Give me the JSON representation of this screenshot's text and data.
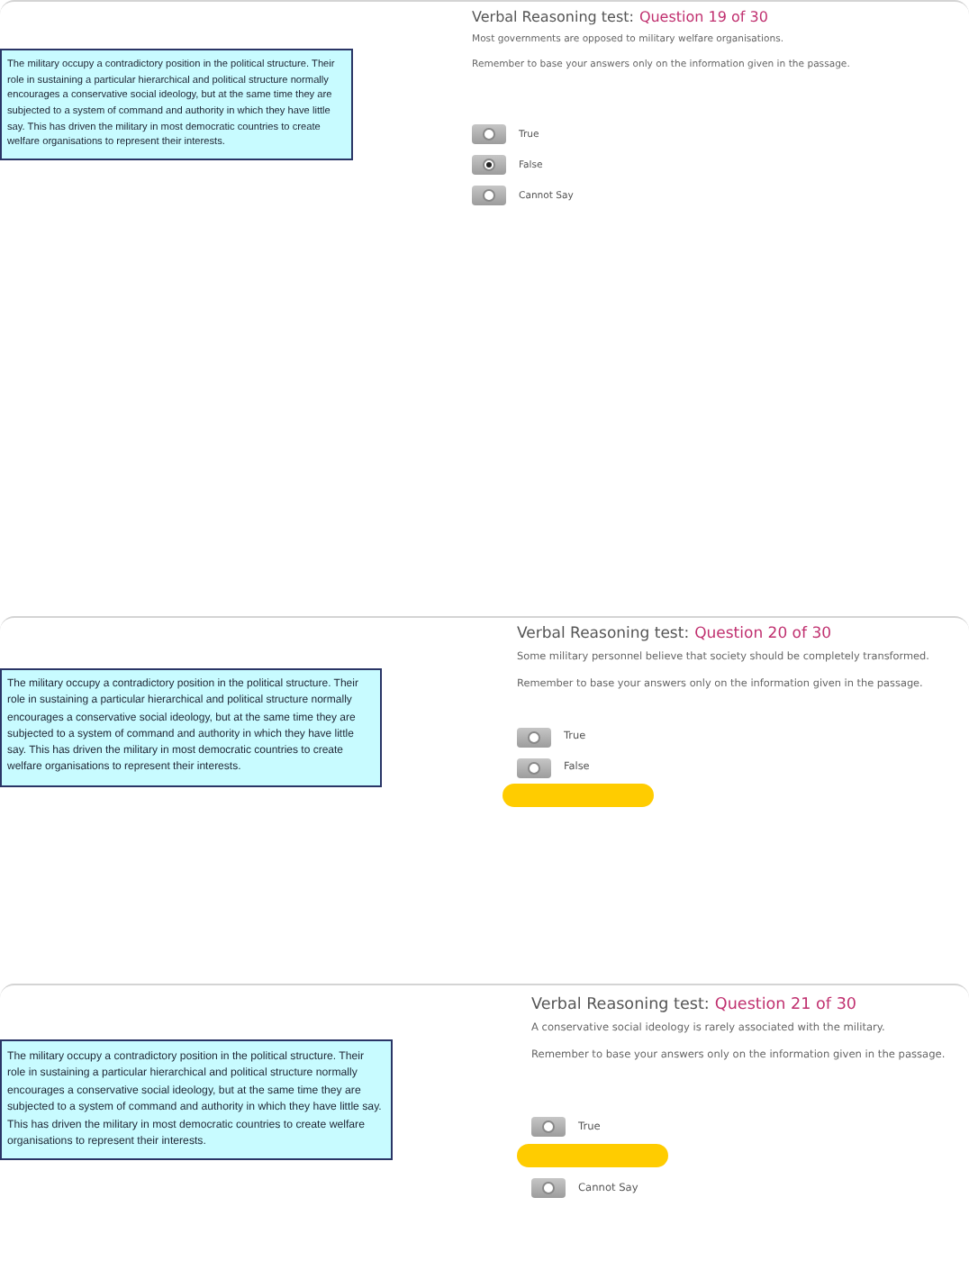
{
  "panels": [
    {
      "test_label": "Verbal Reasoning test:",
      "question_label": "Question 19 of 30",
      "passage": "The military occupy a contradictory position in the political structure. Their role in sustaining a particular hierarchical and political structure normally encourages a conservative social ideology, but at the same time they are subjected to a system of command and authority in which they have little say. This has driven the military in most democratic countries to create welfare organisations to represent their interests.",
      "statement": "Most governments are opposed to military welfare organisations.",
      "instruction": "Remember to base your answers only on the information given in the passage.",
      "options": [
        {
          "kind": "option",
          "label": "True",
          "selected": false
        },
        {
          "kind": "option",
          "label": "False",
          "selected": true
        },
        {
          "kind": "option",
          "label": "Cannot Say",
          "selected": false
        }
      ]
    },
    {
      "test_label": "Verbal Reasoning test:",
      "question_label": "Question 20 of 30",
      "passage": "The military occupy a contradictory position in the political structure. Their role in sustaining a particular hierarchical and political structure normally encourages a conservative social ideology, but at the same time they are subjected to a system of command and authority in which they have little say. This has driven the military in most democratic countries to create welfare organisations to represent their interests.",
      "statement": "Some military personnel believe that society should be completely transformed.",
      "instruction": "Remember to base your answers only on the information given in the passage.",
      "options": [
        {
          "kind": "option",
          "label": "True",
          "selected": false
        },
        {
          "kind": "option",
          "label": "False",
          "selected": false
        },
        {
          "kind": "covered"
        }
      ]
    },
    {
      "test_label": "Verbal Reasoning test:",
      "question_label": "Question 21 of 30",
      "passage": "The military occupy a contradictory position in the political structure. Their role in sustaining a particular hierarchical and political structure normally encourages a conservative social ideology, but at the same time they are subjected to a system of command and authority in which they have little say. This has driven the military in most democratic countries to create welfare organisations to represent their interests.",
      "statement": "A conservative social ideology is rarely associated with the military.",
      "instruction": "Remember to base your answers only on the information given in the passage.",
      "options": [
        {
          "kind": "option",
          "label": "True",
          "selected": false
        },
        {
          "kind": "covered"
        },
        {
          "kind": "option",
          "label": "Cannot Say",
          "selected": false
        }
      ]
    }
  ]
}
